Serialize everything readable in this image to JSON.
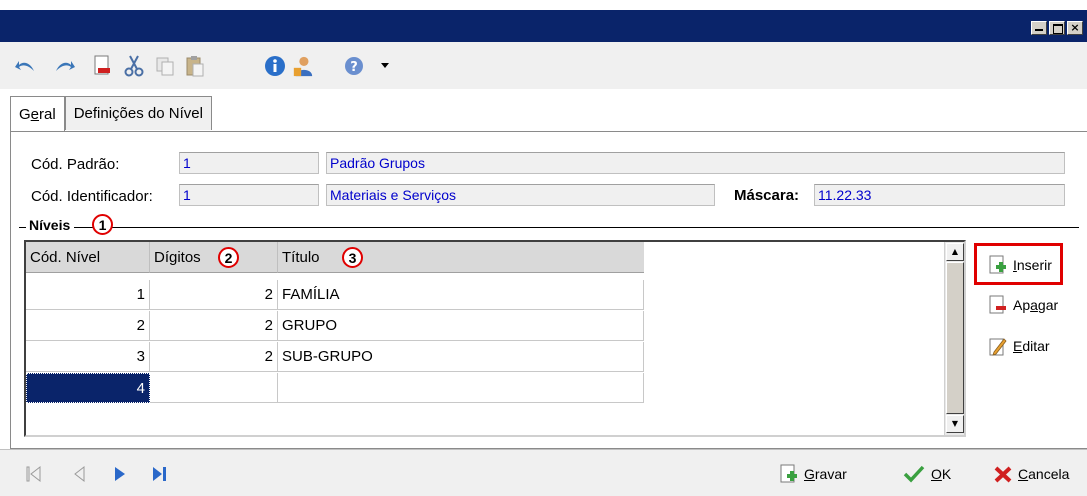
{
  "toolbar": {
    "icons": [
      "undo-icon",
      "redo-icon",
      "new-document-icon",
      "cut-icon",
      "copy-icon",
      "paste-icon",
      "info-icon",
      "user-icon",
      "help-icon",
      "dropdown-arrow-icon"
    ]
  },
  "tabs": [
    {
      "label_pre": "G",
      "label_u": "e",
      "label_post": "ral",
      "active": true
    },
    {
      "label": "Definições do Nível",
      "active": false
    }
  ],
  "form": {
    "cod_padrao_label": "Cód. Padrão:",
    "cod_padrao_value": "1",
    "cod_padrao_desc": "Padrão Grupos",
    "cod_ident_label": "Cód. Identificador:",
    "cod_ident_value": "1",
    "cod_ident_desc": "Materiais e Serviços",
    "mascara_label": "Máscara:",
    "mascara_value": "11.22.33"
  },
  "niveis": {
    "group_label": "Níveis",
    "badges": [
      "1",
      "2",
      "3"
    ],
    "columns": [
      "Cód. Nível",
      "Dígitos",
      "Título"
    ],
    "rows": [
      {
        "cod": "1",
        "digitos": "2",
        "titulo": "FAMÍLIA"
      },
      {
        "cod": "2",
        "digitos": "2",
        "titulo": "GRUPO"
      },
      {
        "cod": "3",
        "digitos": "2",
        "titulo": "SUB-GRUPO"
      },
      {
        "cod": "4",
        "digitos": "",
        "titulo": ""
      }
    ]
  },
  "side_buttons": {
    "inserir_u": "I",
    "inserir_rest": "nserir",
    "apagar_pre": "Ap",
    "apagar_u": "a",
    "apagar_rest": "gar",
    "editar_u": "E",
    "editar_rest": "ditar",
    "highlight_color": "#e00000"
  },
  "bottom": {
    "nav_icons": [
      "first-record-icon",
      "previous-record-icon",
      "next-record-icon",
      "last-record-icon"
    ],
    "gravar_u": "G",
    "gravar_rest": "ravar",
    "ok_u": "O",
    "ok_rest": "K",
    "cancelar_u": "C",
    "cancelar_rest": "ancela"
  },
  "colors": {
    "titlebar": "#0a246a",
    "field_text": "#0000cc",
    "selected_cell": "#0a246a"
  }
}
